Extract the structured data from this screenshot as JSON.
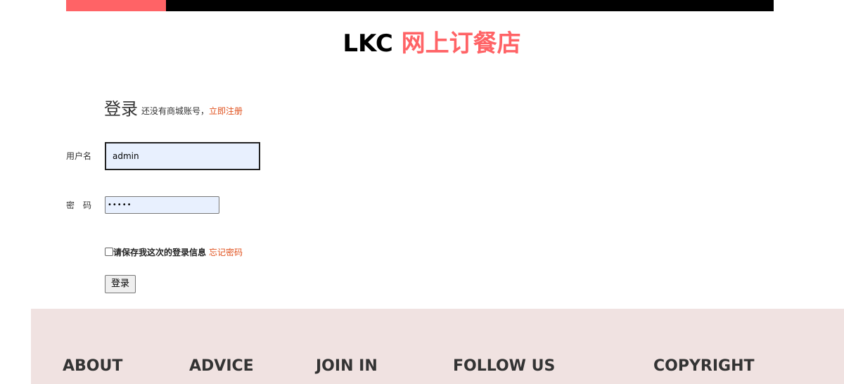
{
  "header": {
    "brand_prefix": "LKC",
    "brand_name": "网上订餐店"
  },
  "login": {
    "title": "登录",
    "hint": "还没有商城账号，",
    "register_link": "立即注册",
    "username_label": "用户名",
    "username_value": "admin",
    "password_label": "密　码",
    "password_value": "•••••",
    "remember_text": "请保存我这次的登录信息",
    "forgot_link": "忘记密码",
    "submit_label": "登录"
  },
  "footer": {
    "columns": [
      "ABOUT",
      "ADVICE",
      "JOIN IN",
      "FOLLOW US",
      "COPYRIGHT"
    ]
  },
  "colors": {
    "accent": "#ff6366",
    "link": "#e0501c",
    "footer_bg": "#f0e2e1"
  }
}
